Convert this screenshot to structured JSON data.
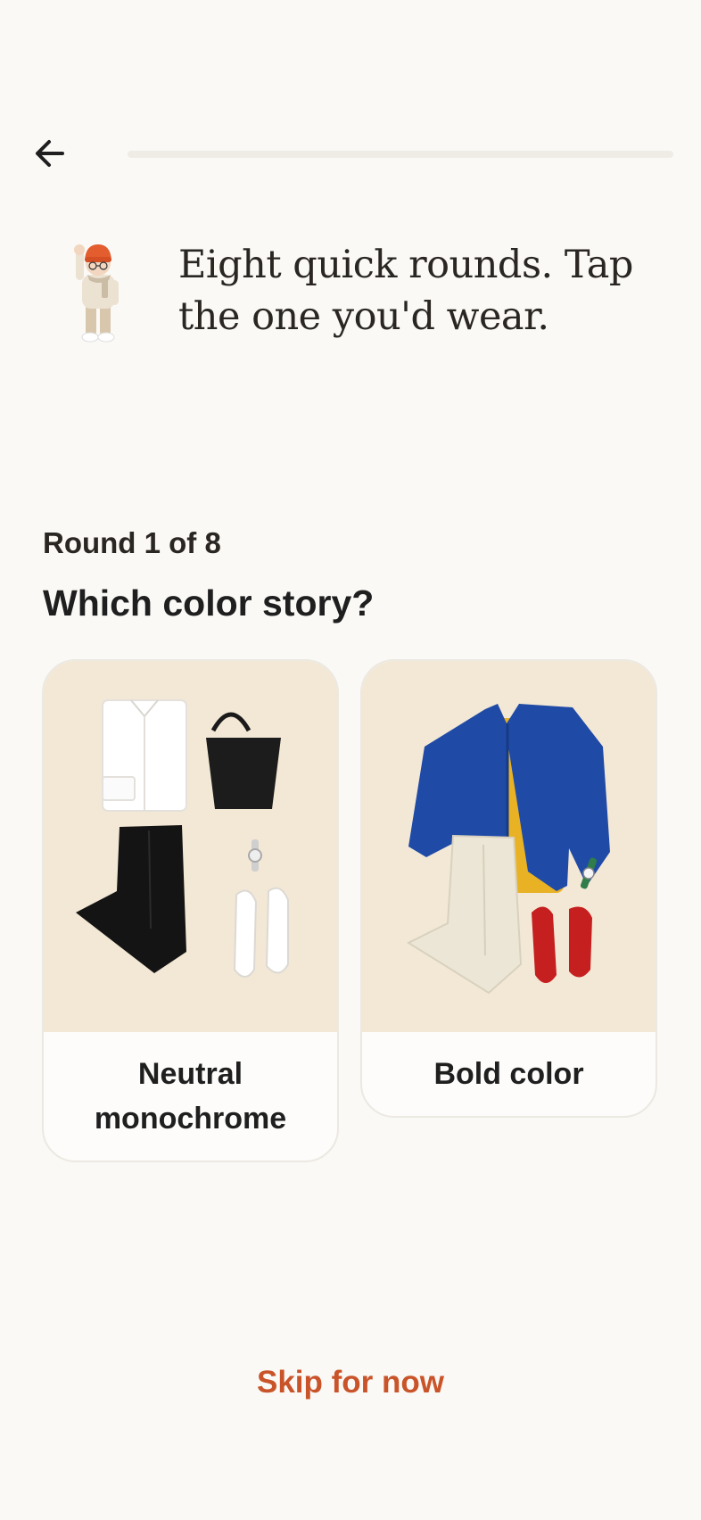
{
  "nav": {
    "back_icon": "arrow-left-icon",
    "progress_fraction": 0.0
  },
  "header": {
    "mascot_icon": "waving-mascot-icon",
    "headline": "Eight quick rounds. Tap the one you'd wear."
  },
  "round": {
    "label": "Round 1 of 8",
    "question": "Which color story?"
  },
  "options": [
    {
      "label": "Neutral monochrome",
      "image": "outfit-neutral-monochrome-image"
    },
    {
      "label": "Bold color",
      "image": "outfit-bold-color-image"
    }
  ],
  "footer": {
    "skip_label": "Skip for now"
  },
  "colors": {
    "background": "#faf9f6",
    "accent": "#c9542a",
    "card_image_bg": "#f3e8d5"
  }
}
